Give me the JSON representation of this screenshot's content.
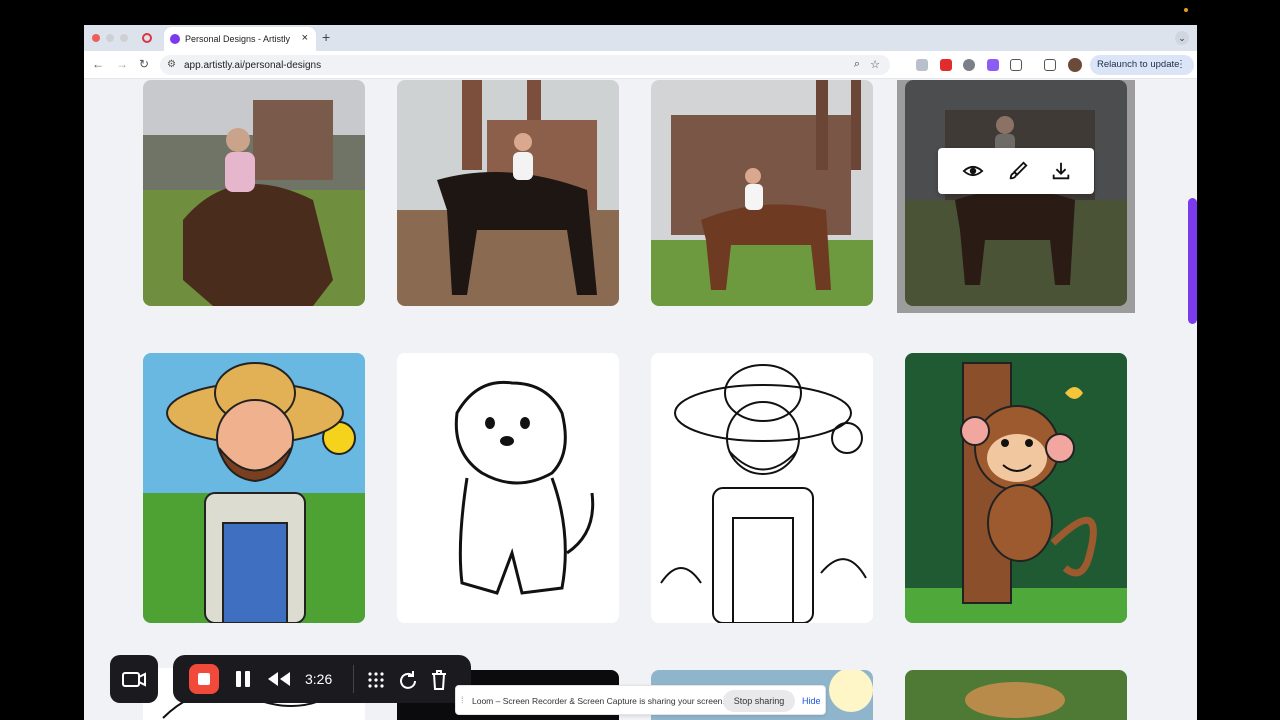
{
  "browser": {
    "tab_title": "Personal Designs - Artistly",
    "url": "app.artistly.ai/personal-designs",
    "relaunch_label": "Relaunch to update"
  },
  "gallery": {
    "hover_actions": [
      "view-icon",
      "edit-brush-icon",
      "download-icon"
    ]
  },
  "loom": {
    "timer": "3:26",
    "share_message": "Loom – Screen Recorder & Screen Capture is sharing your screen.",
    "stop_label": "Stop sharing",
    "hide_label": "Hide"
  },
  "colors": {
    "accent": "#7c3aed",
    "record": "#f24a3a",
    "recorder_bg": "#1b1b1f"
  }
}
